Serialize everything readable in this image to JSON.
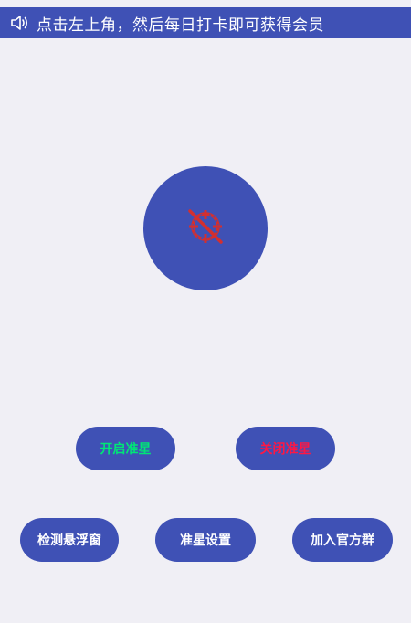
{
  "notice": {
    "icon": "speaker-icon",
    "text": "点击左上角，然后每日打卡即可获得会员"
  },
  "crosshair": {
    "icon": "crosshair-off-icon",
    "icon_color": "#d32f2f"
  },
  "buttons": {
    "open": {
      "label": "开启准星",
      "color": "#00e676"
    },
    "close": {
      "label": "关闭准星",
      "color": "#ff1744"
    },
    "detect": {
      "label": "检测悬浮窗"
    },
    "settings": {
      "label": "准星设置"
    },
    "join": {
      "label": "加入官方群"
    }
  },
  "colors": {
    "accent": "#3f51b5",
    "background": "#f0eff5"
  }
}
